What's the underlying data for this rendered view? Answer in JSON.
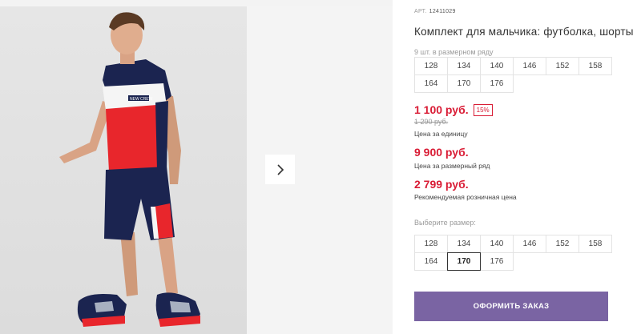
{
  "product": {
    "article_label": "АРТ.",
    "article_number": "12411029",
    "title": "Комплект для мальчика: футболка, шорты",
    "range_note": "9 шт. в размерном ряду",
    "range_sizes": [
      "128",
      "134",
      "140",
      "146",
      "152",
      "158",
      "164",
      "170",
      "176"
    ],
    "price_unit": "1 100 руб.",
    "discount": "15%",
    "old_price": "1 290 руб.",
    "price_unit_note": "Цена за единицу",
    "price_range": "9 900 руб.",
    "price_range_note": "Цена за размерный ряд",
    "price_retail": "2 799 руб.",
    "price_retail_note": "Рекомендуемая розничная цена",
    "choose_size_label": "Выберите размер:",
    "sizes": [
      "128",
      "134",
      "140",
      "146",
      "152",
      "158",
      "164",
      "170",
      "176"
    ],
    "selected_size": "170",
    "order_button": "ОФОРМИТЬ ЗАКАЗ",
    "photo_print_text": "NEW CREW"
  },
  "gallery": {
    "next_icon": "chevron-right-icon"
  },
  "colors": {
    "price": "#d91c35",
    "order_button": "#7a64a3",
    "shirt_navy": "#1b2450",
    "shirt_red": "#e8262c"
  }
}
